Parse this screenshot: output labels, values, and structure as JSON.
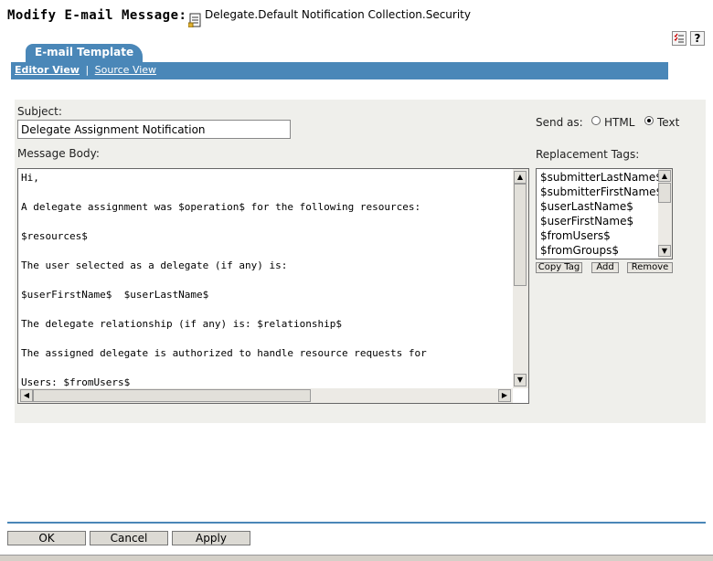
{
  "header": {
    "title": "Modify E-mail Message:",
    "object_name": "Delegate.Default Notification Collection.Security",
    "icons": [
      "document-icon",
      "checklist-icon",
      "help-icon"
    ]
  },
  "tabs": {
    "active": "E-mail Template"
  },
  "views": {
    "editor": "Editor View",
    "separator": "|",
    "source": "Source View"
  },
  "form": {
    "subject_label": "Subject:",
    "subject_value": "Delegate Assignment Notification",
    "body_label": "Message Body:",
    "body_lines": [
      "Hi,",
      "",
      "A delegate assignment was $operation$ for the following resources:",
      "",
      "$resources$",
      "",
      "The user selected as a delegate (if any) is:",
      "",
      "$userFirstName$  $userLastName$",
      "",
      "The delegate relationship (if any) is: $relationship$",
      "",
      "The assigned delegate is authorized to handle resource requests for",
      "",
      "Users: $fromUsers$"
    ],
    "send_as_label": "Send as:",
    "send_as_options": [
      "HTML",
      "Text"
    ],
    "send_as_selected": "Text",
    "tags_label": "Replacement Tags:",
    "tags": [
      "$submitterLastName$",
      "$submitterFirstName$",
      "$userLastName$",
      "$userFirstName$",
      "$fromUsers$",
      "$fromGroups$"
    ],
    "copy_tag": "Copy Tag",
    "add": "Add",
    "remove": "Remove"
  },
  "footer": {
    "ok": "OK",
    "cancel": "Cancel",
    "apply": "Apply"
  },
  "colors": {
    "accent": "#4a87b8",
    "panel": "#efefeb"
  }
}
